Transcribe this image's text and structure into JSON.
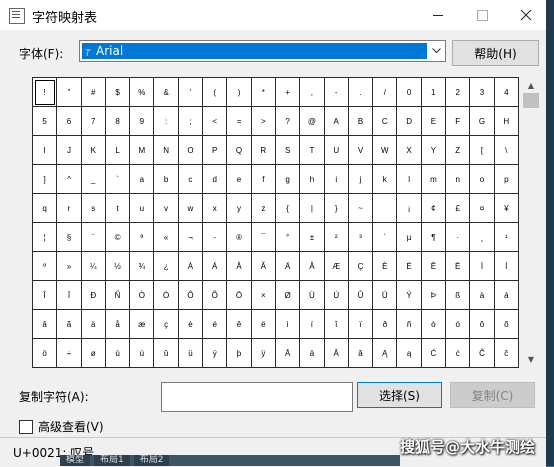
{
  "window": {
    "title": "字符映射表",
    "icon": "charmap-icon"
  },
  "font": {
    "label": "字体(F):",
    "value": "Arial",
    "help_button": "帮助(H)"
  },
  "grid": {
    "columns": 20,
    "selected_index": 0,
    "chars": [
      "!",
      "\"",
      "#",
      "$",
      "%",
      "&",
      "'",
      "(",
      ")",
      "*",
      "+",
      ",",
      "-",
      ".",
      "/",
      "0",
      "1",
      "2",
      "3",
      "4",
      "5",
      "6",
      "7",
      "8",
      "9",
      ":",
      ";",
      "<",
      "=",
      ">",
      "?",
      "@",
      "A",
      "B",
      "C",
      "D",
      "E",
      "F",
      "G",
      "H",
      "I",
      "J",
      "K",
      "L",
      "M",
      "N",
      "O",
      "P",
      "Q",
      "R",
      "S",
      "T",
      "U",
      "V",
      "W",
      "X",
      "Y",
      "Z",
      "[",
      "\\",
      "]",
      "^",
      "_",
      "`",
      "a",
      "b",
      "c",
      "d",
      "e",
      "f",
      "g",
      "h",
      "i",
      "j",
      "k",
      "l",
      "m",
      "n",
      "o",
      "p",
      "q",
      "r",
      "s",
      "t",
      "u",
      "v",
      "w",
      "x",
      "y",
      "z",
      "{",
      "|",
      "}",
      "~",
      " ",
      "¡",
      "¢",
      "£",
      "¤",
      "¥",
      "¦",
      "§",
      "¨",
      "©",
      "ª",
      "«",
      "¬",
      "-",
      "®",
      "¯",
      "°",
      "±",
      "²",
      "³",
      "´",
      "µ",
      "¶",
      "·",
      "¸",
      "¹",
      "º",
      "»",
      "¼",
      "½",
      "¾",
      "¿",
      "À",
      "Á",
      "Â",
      "Ã",
      "Ä",
      "Å",
      "Æ",
      "Ç",
      "È",
      "É",
      "Ê",
      "Ë",
      "Ì",
      "Í",
      "Î",
      "Ï",
      "Ð",
      "Ñ",
      "Ò",
      "Ó",
      "Ô",
      "Õ",
      "Ö",
      "×",
      "Ø",
      "Ù",
      "Ú",
      "Û",
      "Ü",
      "Ý",
      "Þ",
      "ß",
      "à",
      "á",
      "â",
      "ã",
      "ä",
      "å",
      "æ",
      "ç",
      "è",
      "é",
      "ê",
      "ë",
      "ì",
      "í",
      "î",
      "ï",
      "ð",
      "ñ",
      "ò",
      "ó",
      "ô",
      "õ",
      "ö",
      "÷",
      "ø",
      "ù",
      "ú",
      "û",
      "ü",
      "ý",
      "þ",
      "ÿ",
      "Ā",
      "ā",
      "Ă",
      "ă",
      "Ą",
      "ą",
      "Ć",
      "ć",
      "Ĉ",
      "ĉ"
    ]
  },
  "copy": {
    "label": "复制字符(A):",
    "value": "",
    "select_button": "选择(S)",
    "copy_button": "复制(C)"
  },
  "advanced": {
    "label": "高级查看(V)",
    "checked": false
  },
  "status": {
    "text": "U+0021: 叹号"
  },
  "taskbar": {
    "items": [
      "模型",
      "布局1",
      "布局2"
    ]
  },
  "watermark": "搜狐号@大水牛测绘"
}
